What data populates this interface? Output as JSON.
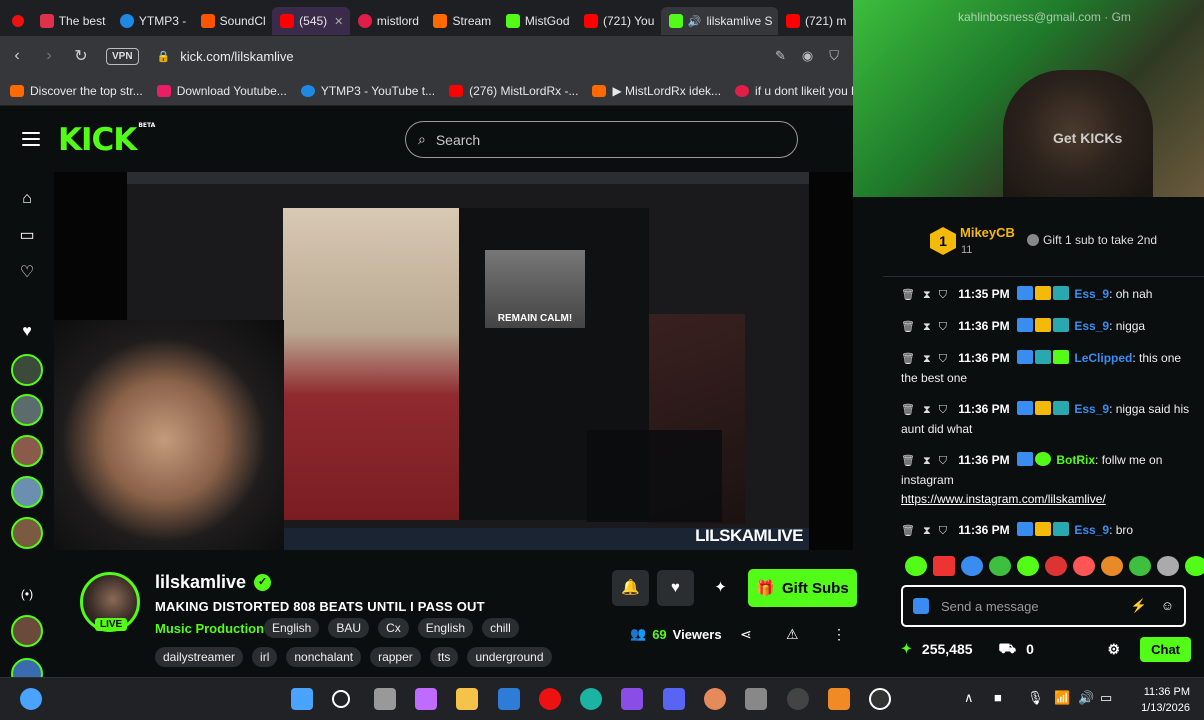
{
  "tabs": [
    "The best",
    "YTMP3 -",
    "SoundCl",
    "(545)",
    "mistlord",
    "Stream",
    "MistGod",
    "(721) You",
    "lilskamlive S",
    "(721) m"
  ],
  "address": {
    "vpn": "VPN",
    "url": "kick.com/lilskamlive"
  },
  "bookmarks": [
    "Discover the top str...",
    "Download Youtube...",
    "YTMP3 - YouTube t...",
    "(276) MistLordRx -...",
    "▶ MistLordRx idek...",
    "if u dont likeit you b..."
  ],
  "site": {
    "logo": "KICK",
    "beta": "BETA",
    "search_placeholder": "Search"
  },
  "video": {
    "gif_caption": "REMAIN CALM!",
    "watermark": "LILSKAMLIVE"
  },
  "stream": {
    "channel": "lilskamlive",
    "live_label": "LIVE",
    "title": "MAKING DISTORTED 808 BEATS UNTIL I PASS OUT",
    "category": "Music Production",
    "tags": [
      "English",
      "BAU",
      "Cx",
      "English",
      "chill",
      "dailystreamer",
      "irl",
      "nonchalant",
      "rapper",
      "tts",
      "underground"
    ],
    "gift_label": "Gift Subs",
    "viewers": "69",
    "viewers_label": "Viewers"
  },
  "webcam": {
    "email": "kahlinbosness@gmail.com · Gm",
    "get_kicks": "Get KICKs"
  },
  "chat": {
    "leader": {
      "rank": "1",
      "name": "MikeyCB",
      "count": "11",
      "hint": "Gift 1 sub to take 2nd"
    },
    "messages": [
      {
        "time": "11:35 PM",
        "user": "Ess_9",
        "text": "oh nah"
      },
      {
        "time": "11:36 PM",
        "user": "Ess_9",
        "text": "nigga"
      },
      {
        "time": "11:36 PM",
        "user": "LeClipped",
        "text": "this one the best one"
      },
      {
        "time": "11:36 PM",
        "user": "Ess_9",
        "text": "nigga said his aunt did what"
      },
      {
        "time": "11:36 PM",
        "user": "BotRix",
        "text": "follw me on instagram",
        "link": "https://www.instagram.com/lilskamlive/"
      },
      {
        "time": "11:36 PM",
        "user": "Ess_9",
        "text": "bro"
      }
    ],
    "input_placeholder": "Send a message",
    "kicks_balance": "255,485",
    "store_count": "0",
    "send_label": "Chat"
  },
  "taskbar": {
    "time": "11:36 PM",
    "date": "1/13/2026"
  },
  "colors": {
    "kick_green": "#53fc18",
    "background": "#0b0e0f",
    "username_blue": "#3a8df0",
    "leader_gold": "#f5b90a"
  }
}
